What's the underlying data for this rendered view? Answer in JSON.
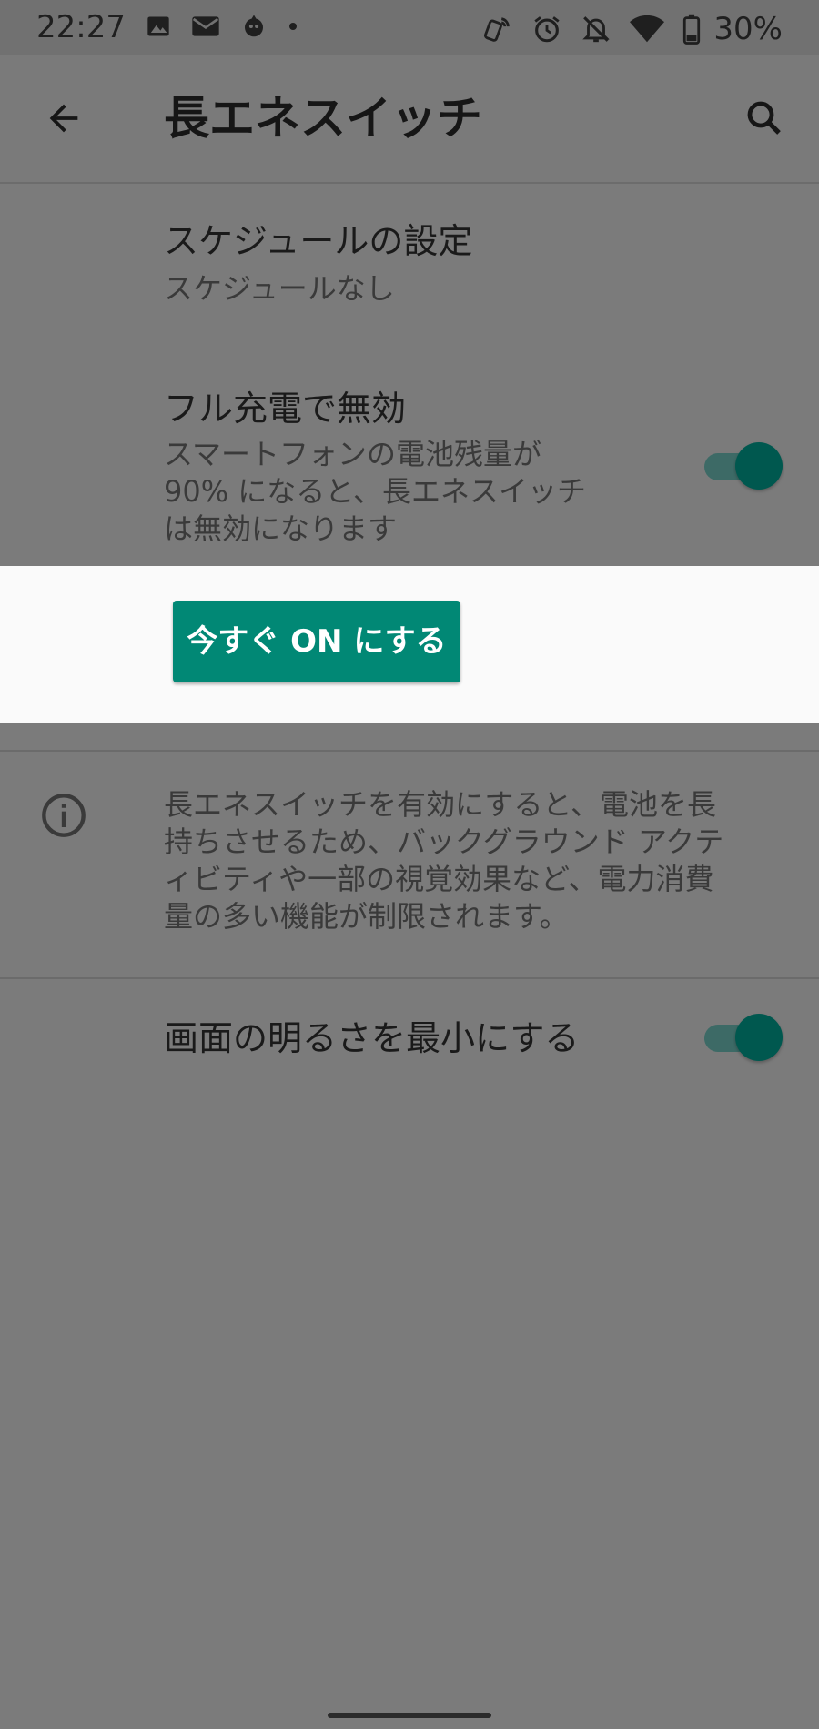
{
  "status_bar": {
    "time": "22:27",
    "battery": "30%",
    "icons_left": [
      "image-icon",
      "mail-icon",
      "app-notification-icon",
      "dot-icon"
    ],
    "icons_right": [
      "nfc-icon",
      "alarm-icon",
      "mute-icon",
      "wifi-icon",
      "battery-icon"
    ]
  },
  "app_bar": {
    "title": "長エネスイッチ"
  },
  "settings": {
    "schedule": {
      "title": "スケジュールの設定",
      "subtitle": "スケジュールなし"
    },
    "full_charge": {
      "title": "フル充電で無効",
      "subtitle_lines": [
        "スマートフォンの電池残量が",
        "90% になると、長エネスイッチ",
        "は無効になります"
      ],
      "toggle_on": true
    },
    "turn_on_now_label": "今すぐ ON にする",
    "info_lines": [
      "長エネスイッチを有効にすると、電池を長",
      "持ちさせるため、バックグラウンド アクテ",
      "ィビティや一部の視覚効果など、電力消費",
      "量の多い機能が制限されます。"
    ],
    "min_brightness": {
      "title": "画面の明るさを最小にする",
      "toggle_on": true
    }
  },
  "colors": {
    "accent": "#018875",
    "toggle_thumb": "#00584f",
    "scrim": "#7b7b7b",
    "highlight": "#fafafa"
  }
}
